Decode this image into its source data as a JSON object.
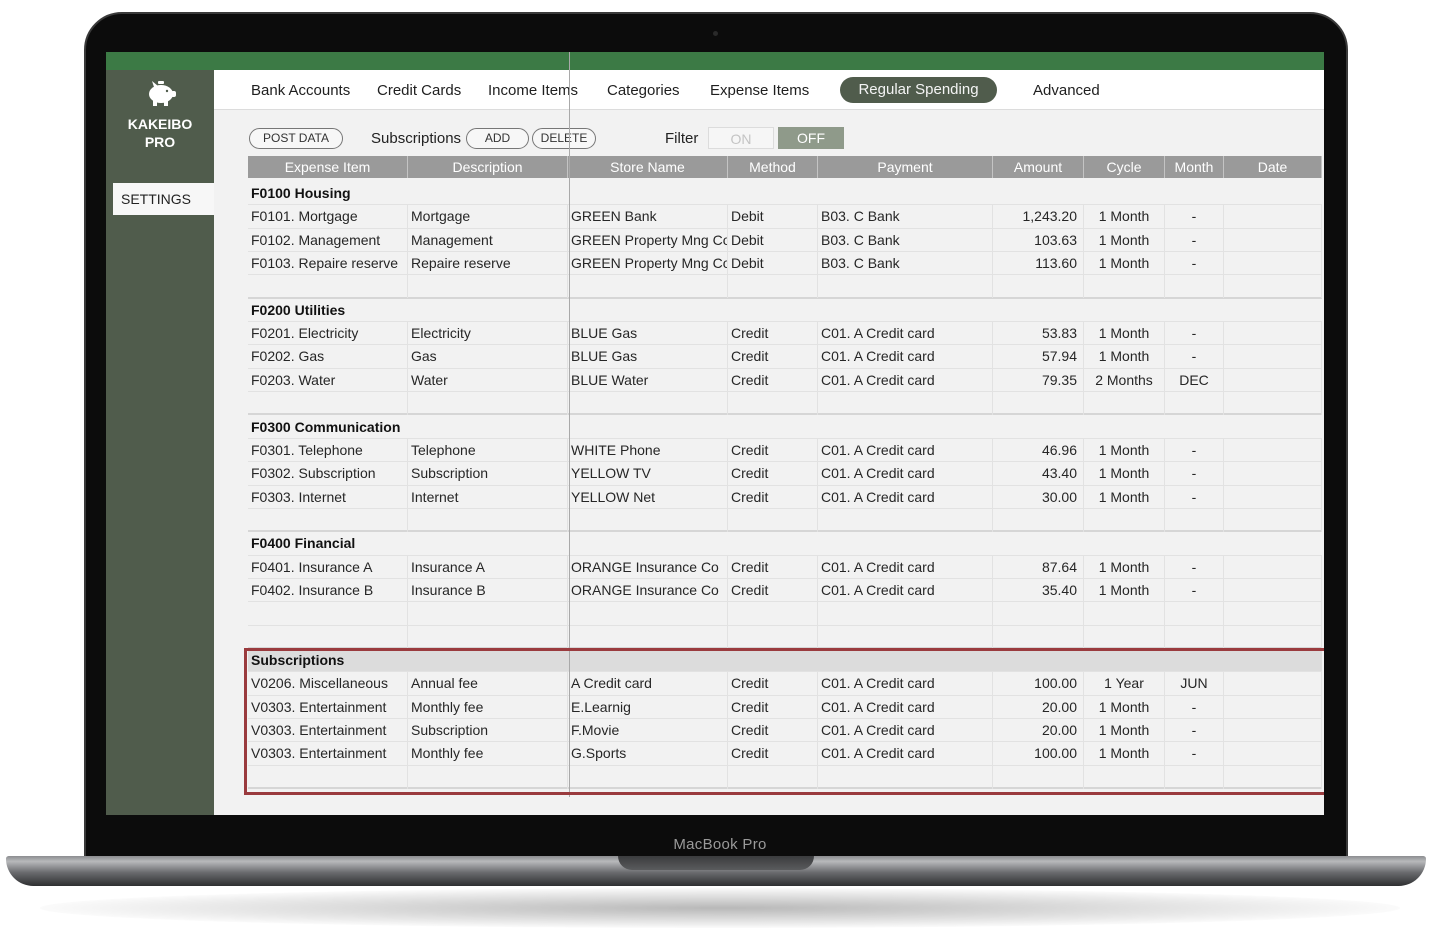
{
  "device": {
    "brand": "MacBook Pro"
  },
  "app": {
    "logo_icon": "piggy-bank-icon",
    "name": "KAKEIBO\nPRO",
    "settings_label": "SETTINGS"
  },
  "nav": {
    "items": [
      "Bank Accounts",
      "Credit Cards",
      "Income Items",
      "Categories",
      "Expense Items",
      "Regular Spending",
      "Advanced"
    ],
    "active": "Regular Spending"
  },
  "controls": {
    "post_data": "POST DATA",
    "subscriptions_label": "Subscriptions",
    "add": "ADD",
    "delete": "DELETE",
    "filter_label": "Filter",
    "filter_on": "ON",
    "filter_off": "OFF",
    "filter_state": "OFF"
  },
  "table": {
    "columns": [
      "Expense Item",
      "Description",
      "Store Name",
      "Method",
      "Payment",
      "Amount",
      "Cycle",
      "Month",
      "Date"
    ],
    "groups": [
      {
        "title": "F0100 Housing",
        "rows": [
          [
            "F0101. Mortgage",
            "Mortgage",
            "GREEN Bank",
            "Debit",
            "B03. C Bank",
            "1,243.20",
            "1 Month",
            "-",
            ""
          ],
          [
            "F0102. Management",
            "Management",
            "GREEN Property Mng Co",
            "Debit",
            "B03. C Bank",
            "103.63",
            "1 Month",
            "-",
            ""
          ],
          [
            "F0103. Repaire reserve",
            "Repaire reserve",
            "GREEN Property Mng Co",
            "Debit",
            "B03. C Bank",
            "113.60",
            "1 Month",
            "-",
            ""
          ]
        ]
      },
      {
        "title": "F0200 Utilities",
        "rows": [
          [
            "F0201. Electricity",
            "Electricity",
            "BLUE Gas",
            "Credit",
            "C01. A Credit card",
            "53.83",
            "1 Month",
            "-",
            ""
          ],
          [
            "F0202. Gas",
            "Gas",
            "BLUE Gas",
            "Credit",
            "C01. A Credit card",
            "57.94",
            "1 Month",
            "-",
            ""
          ],
          [
            "F0203. Water",
            "Water",
            "BLUE Water",
            "Credit",
            "C01. A Credit card",
            "79.35",
            "2 Months",
            "DEC",
            ""
          ]
        ]
      },
      {
        "title": "F0300 Communication",
        "rows": [
          [
            "F0301. Telephone",
            "Telephone",
            "WHITE Phone",
            "Credit",
            "C01. A Credit card",
            "46.96",
            "1 Month",
            "-",
            ""
          ],
          [
            "F0302. Subscription",
            "Subscription",
            "YELLOW TV",
            "Credit",
            "C01. A Credit card",
            "43.40",
            "1 Month",
            "-",
            ""
          ],
          [
            "F0303. Internet",
            "Internet",
            "YELLOW Net",
            "Credit",
            "C01. A Credit card",
            "30.00",
            "1 Month",
            "-",
            ""
          ]
        ]
      },
      {
        "title": "F0400 Financial",
        "rows": [
          [
            "F0401. Insurance A",
            "Insurance A",
            "ORANGE Insurance Co",
            "Credit",
            "C01. A Credit card",
            "87.64",
            "1 Month",
            "-",
            ""
          ],
          [
            "F0402. Insurance B",
            "Insurance B",
            "ORANGE Insurance Co",
            "Credit",
            "C01. A Credit card",
            "35.40",
            "1 Month",
            "-",
            ""
          ]
        ]
      },
      {
        "title": "Subscriptions",
        "highlighted": true,
        "rows": [
          [
            "V0206. Miscellaneous",
            "Annual fee",
            "A Credit card",
            "Credit",
            "C01. A Credit card",
            "100.00",
            "1 Year",
            "JUN",
            ""
          ],
          [
            "V0303. Entertainment",
            "Monthly fee",
            "E.Learnig",
            "Credit",
            "C01. A Credit card",
            "20.00",
            "1 Month",
            "-",
            ""
          ],
          [
            "V0303. Entertainment",
            "Subscription",
            "F.Movie",
            "Credit",
            "C01. A Credit card",
            "20.00",
            "1 Month",
            "-",
            ""
          ],
          [
            "V0303. Entertainment",
            "Monthly fee",
            "G.Sports",
            "Credit",
            "C01. A Credit card",
            "100.00",
            "1 Month",
            "-",
            ""
          ]
        ]
      }
    ]
  },
  "colors": {
    "accent": "#505c4c",
    "topbar": "#3c7a45",
    "highlight_border": "#9a3b3e",
    "header_bg": "#9a9a9a"
  }
}
